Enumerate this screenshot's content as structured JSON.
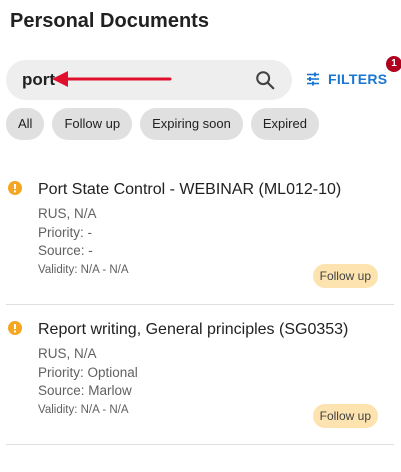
{
  "page": {
    "title": "Personal Documents"
  },
  "search": {
    "value": "port",
    "placeholder": ""
  },
  "filters": {
    "label": "FILTERS",
    "badge_count": "1",
    "badge_color": "#b00020",
    "accent": "#1976d2"
  },
  "chips": [
    {
      "label": "All"
    },
    {
      "label": "Follow up"
    },
    {
      "label": "Expiring soon"
    },
    {
      "label": "Expired"
    }
  ],
  "documents": [
    {
      "title": "Port State Control - WEBINAR (ML012-10)",
      "location": "RUS, N/A",
      "priority": "Priority: -",
      "source": "Source: -",
      "validity": "Validity: N/A - N/A",
      "status": "Follow up"
    },
    {
      "title": "Report writing, General principles (SG0353)",
      "location": "RUS, N/A",
      "priority": "Priority: Optional",
      "source": "Source: Marlow",
      "validity": "Validity: N/A - N/A",
      "status": "Follow up"
    }
  ],
  "colors": {
    "warning": "#f5a623",
    "status_bg": "#fde3b0",
    "annotation_arrow": "#e0102c"
  }
}
